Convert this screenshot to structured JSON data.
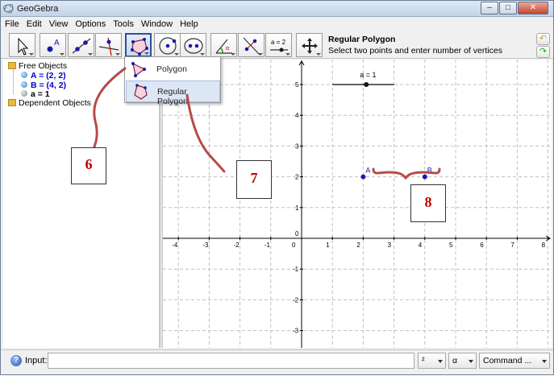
{
  "window": {
    "title": "GeoGebra",
    "controls": {
      "minimize": "–",
      "maximize": "□",
      "close": "✕"
    }
  },
  "menu": [
    "File",
    "Edit",
    "View",
    "Options",
    "Tools",
    "Window",
    "Help"
  ],
  "toolbar": {
    "tools": [
      {
        "name": "move",
        "icon": "arrow-cursor-icon"
      },
      {
        "name": "point",
        "icon": "point-a-icon",
        "label": "A"
      },
      {
        "name": "line",
        "icon": "line-through-points-icon"
      },
      {
        "name": "perpendicular",
        "icon": "perpendicular-line-icon"
      },
      {
        "name": "polygon",
        "icon": "polygon-icon",
        "selected": true
      },
      {
        "name": "circle",
        "icon": "circle-center-point-icon"
      },
      {
        "name": "ellipse",
        "icon": "ellipse-icon"
      },
      {
        "name": "angle",
        "icon": "angle-icon"
      },
      {
        "name": "reflect",
        "icon": "reflect-line-icon"
      },
      {
        "name": "slider",
        "icon": "slider-icon",
        "label": "a = 2"
      },
      {
        "name": "move-graphics",
        "icon": "move-graphics-icon"
      }
    ],
    "help_title": "Regular Polygon",
    "help_desc": "Select two points and enter number of vertices",
    "undo_icon": "undo-icon",
    "redo_icon": "redo-icon"
  },
  "dropdown": {
    "items": [
      {
        "label": "Polygon",
        "icon": "polygon-icon"
      },
      {
        "label": "Regular Polygon",
        "icon": "regular-polygon-icon",
        "highlighted": true
      }
    ]
  },
  "algebra": {
    "free_objects": "Free Objects",
    "items": [
      {
        "text": "A = (2, 2)",
        "color": "blue"
      },
      {
        "text": "B = (4, 2)",
        "color": "blue"
      },
      {
        "text": "a = 1",
        "color": "black"
      }
    ],
    "dependent_objects": "Dependent Objects"
  },
  "graphics": {
    "x_ticks": [
      "-4",
      "-3",
      "-2",
      "-1",
      "0",
      "1",
      "2",
      "3",
      "4",
      "5",
      "6",
      "7",
      "8"
    ],
    "y_ticks": [
      "6",
      "5",
      "4",
      "3",
      "2",
      "1",
      "0",
      "-1",
      "-2",
      "-3"
    ],
    "points": [
      {
        "label": "A",
        "x": 2,
        "y": 2
      },
      {
        "label": "B",
        "x": 4,
        "y": 2
      }
    ],
    "slider_label": "a = 1",
    "slider_value": 1,
    "colors": {
      "point": "#1a1aa6",
      "axis": "#000000",
      "grid": "#c0c0c0",
      "slider_line": "#000000"
    }
  },
  "annotations": [
    {
      "label": "6",
      "color": "#c00000"
    },
    {
      "label": "7",
      "color": "#c00000"
    },
    {
      "label": "8",
      "color": "#c00000"
    }
  ],
  "inputbar": {
    "help_icon": "help-icon",
    "label": "Input:",
    "value": "",
    "exponent_combo": "²",
    "symbol_combo": "α",
    "command_combo": "Command ..."
  }
}
